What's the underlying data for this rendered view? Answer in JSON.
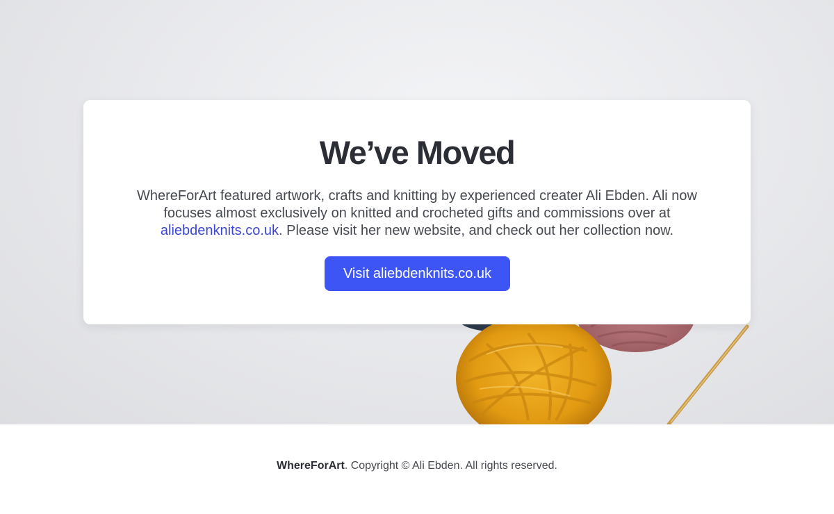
{
  "notice": {
    "title": "We’ve Moved",
    "body_before_link": "WhereForArt featured artwork, crafts and knitting by experienced creater Ali Ebden. Ali now focuses almost exclusively on knitted and crocheted gifts and commissions over at ",
    "link_text": "aliebdenknits.co.uk",
    "body_after_link": ". Please visit her new website, and check out her collection now.",
    "button_label": "Visit aliebdenknits.co.uk"
  },
  "footer": {
    "brand": "WhereForArt",
    "copyright": ". Copyright © Ali Ebden. All rights reserved."
  },
  "colors": {
    "accent": "#3e55f5",
    "link": "#3b46d6",
    "heading": "#2b2e35"
  }
}
